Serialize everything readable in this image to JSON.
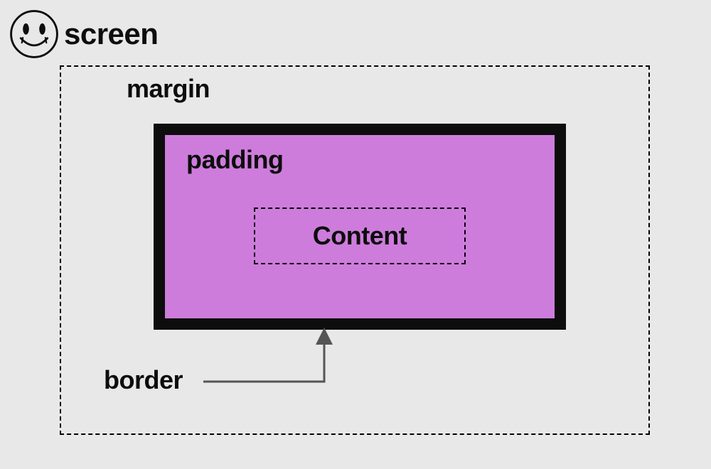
{
  "diagram": {
    "screen_label": "screen",
    "margin_label": "margin",
    "padding_label": "padding",
    "content_label": "Content",
    "border_label": "border"
  },
  "icons": {
    "header_icon": "smiley-icon"
  },
  "colors": {
    "background": "#e8e8e8",
    "box_fill": "#ce7cdc",
    "border_color": "#0d0d0d",
    "text_color": "#0d0d0d",
    "arrow_color": "#555555"
  }
}
